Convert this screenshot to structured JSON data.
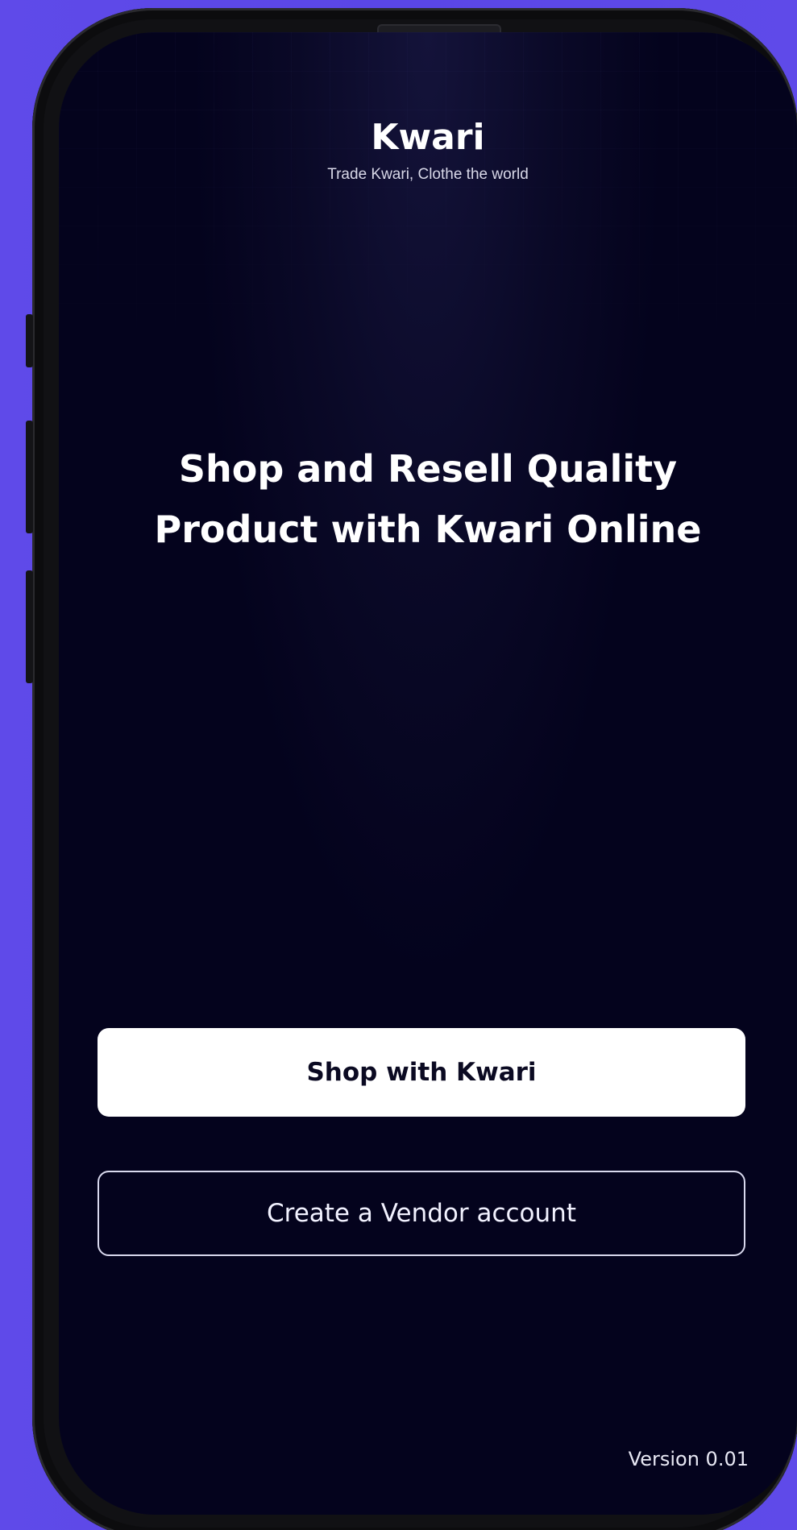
{
  "app": {
    "title": "Kwari",
    "tagline": "Trade Kwari, Clothe the world"
  },
  "hero": {
    "line1": "Shop and Resell Quality",
    "line2": "Product with Kwari Online"
  },
  "actions": {
    "shop_label": "Shop with Kwari",
    "vendor_label": "Create a Vendor account"
  },
  "footer": {
    "version": "Version 0.01"
  },
  "colors": {
    "background": "#5a45e6",
    "screen": "#04031d",
    "primary_button": "#ffffff",
    "outline": "#d9d9ee"
  }
}
